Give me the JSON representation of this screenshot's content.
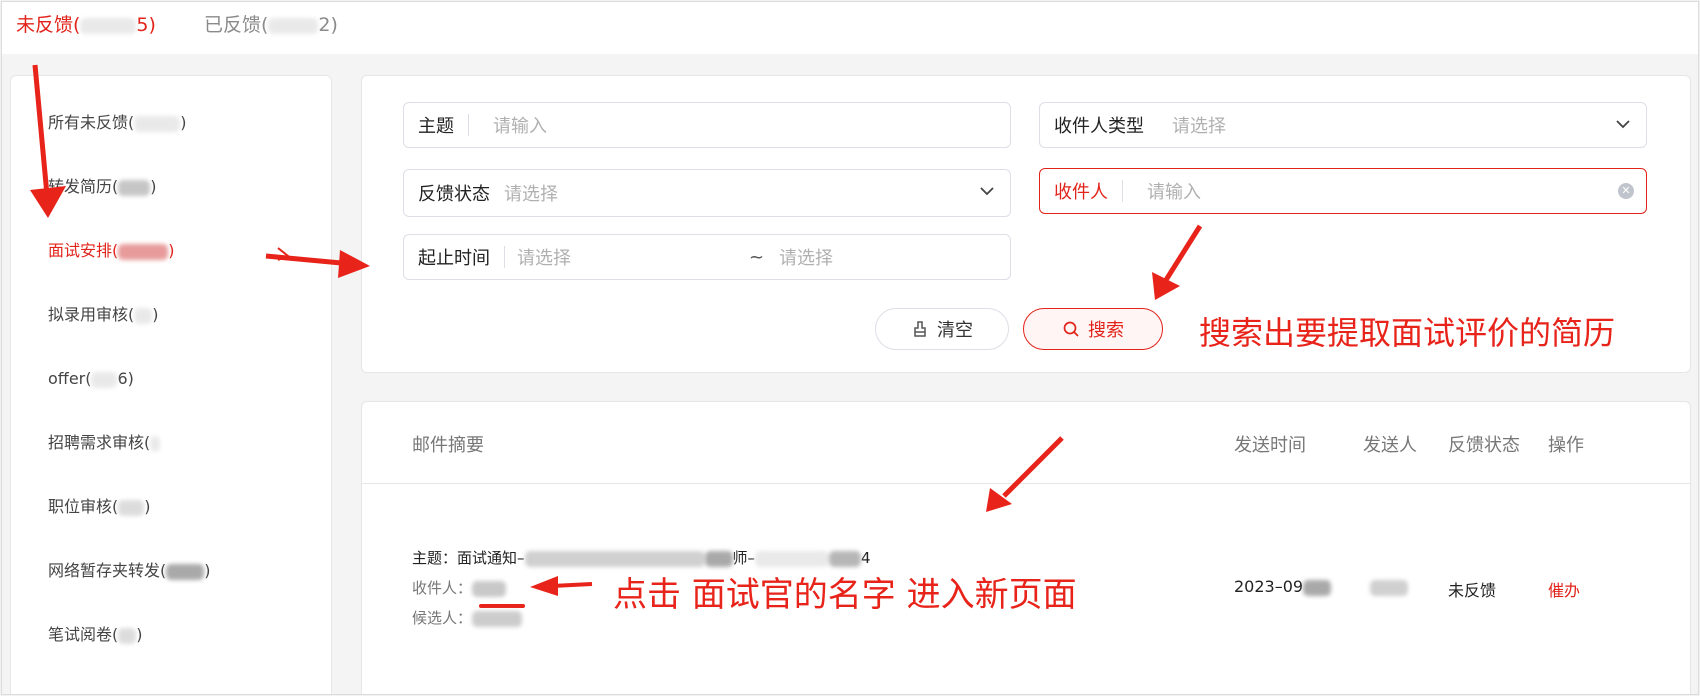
{
  "tabs": {
    "unfeedback": {
      "label": "未反馈(",
      "suffix": "5)"
    },
    "feedback": {
      "label": "已反馈(",
      "suffix": "2)"
    }
  },
  "sidebar": {
    "items": [
      {
        "label": "所有未反馈(",
        "suffix": ")"
      },
      {
        "label": "转发简历(",
        "suffix": ")"
      },
      {
        "label": "面试安排(",
        "suffix": ")"
      },
      {
        "label": "拟录用审核(",
        "suffix": ")"
      },
      {
        "label": "offer(",
        "suffix": "6)"
      },
      {
        "label": "招聘需求审核(",
        "suffix": ""
      },
      {
        "label": "职位审核(",
        "suffix": ")"
      },
      {
        "label": "网络暂存夹转发(",
        "suffix": ")"
      },
      {
        "label": "笔试阅卷(",
        "suffix": ")"
      }
    ]
  },
  "search": {
    "subject": {
      "label": "主题",
      "placeholder": "请输入"
    },
    "recipient_type": {
      "label": "收件人类型",
      "placeholder": "请选择"
    },
    "status": {
      "label": "反馈状态",
      "placeholder": "请选择"
    },
    "recipient": {
      "label": "收件人",
      "placeholder": "请输入"
    },
    "time_range": {
      "label": "起止时间",
      "start_placeholder": "请选择",
      "separator": "~",
      "end_placeholder": "请选择"
    },
    "clear_label": "清空",
    "search_label": "搜索"
  },
  "table": {
    "headers": {
      "summary": "邮件摘要",
      "send_time": "发送时间",
      "sender": "发送人",
      "status": "反馈状态",
      "action": "操作"
    },
    "row": {
      "subject_label": "主题：",
      "subject_value_a": "面试通知–",
      "subject_value_b": "师–",
      "subject_value_c": "4",
      "recipient_label": "收件人：",
      "candidate_label": "候选人：",
      "send_time": "2023–09",
      "status": "未反馈",
      "action": "催办"
    }
  },
  "annotations": {
    "search_note": "搜索出要提取面试评价的简历",
    "click_note": "点击 面试官的名字 进入新页面"
  },
  "colors": {
    "accent": "#e2231a"
  }
}
